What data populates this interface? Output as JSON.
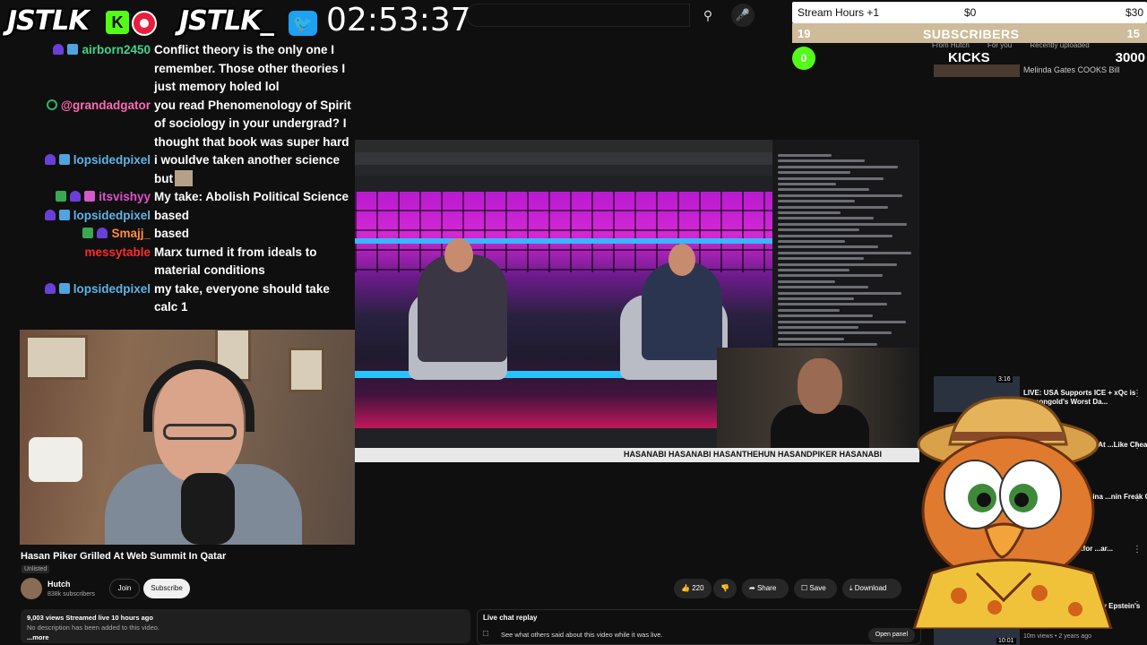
{
  "overlay": {
    "brand_left": "JSTLK",
    "kick_glyph": "K",
    "brand_right": "JSTLK_",
    "clock": "02:53:37",
    "twitter_glyph": "🐦"
  },
  "goals": {
    "hours_title": "Stream Hours +1",
    "hours_min": "$0",
    "hours_max": "$30",
    "subs_current": "19",
    "subs_label": "SUBSCRIBERS",
    "subs_goal": "15",
    "kicks_current": "0",
    "kicks_label": "KICKS",
    "kicks_goal": "3000"
  },
  "mini_tabs": [
    "From Hutch",
    "For you",
    "Recently uploaded"
  ],
  "mini_rec_title": "Melinda Gates COOKS Bill",
  "chat": [
    {
      "user": "airborn2450",
      "color": "#3dd68c",
      "badges": [
        "purple",
        "blue"
      ],
      "text": "Conflict theory is the only one I remember. Those other theories I just memory holed lol"
    },
    {
      "user": "@grandadgator",
      "color": "#ff69b4",
      "badges": [
        "circle"
      ],
      "text": "you read Phenomenology of Spirit of sociology in your undergrad? I thought that book was super hard"
    },
    {
      "user": "lopsidedpixel",
      "color": "#5fb3e8",
      "badges": [
        "purple",
        "blue"
      ],
      "text": "i wouldve taken another science but",
      "emote": true
    },
    {
      "user": "itsvishyy",
      "color": "#e04fcf",
      "badges": [
        "green",
        "purple",
        "pink"
      ],
      "text": "My take: Abolish Political Science"
    },
    {
      "user": "lopsidedpixel",
      "color": "#5fb3e8",
      "badges": [
        "purple",
        "blue"
      ],
      "text": "based"
    },
    {
      "user": "Smajj_",
      "color": "#ff8c3a",
      "badges": [
        "green",
        "purple"
      ],
      "text": "based"
    },
    {
      "user": "messytable",
      "color": "#ff2a2a",
      "badges": [],
      "text": "Marx turned it from ideals to material conditions"
    },
    {
      "user": "lopsidedpixel",
      "color": "#5fb3e8",
      "badges": [
        "purple",
        "blue"
      ],
      "text": "my take, everyone should take calc 1"
    }
  ],
  "embed": {
    "handles": "HASANABI   HASANABI   HASANTHEHUN   HASANDPIKER   HASANABI"
  },
  "video": {
    "title": "Hasan Piker Grilled At Web Summit In Qatar",
    "unlisted": "Unlisted",
    "channel": "Hutch",
    "subscribers": "838k subscribers",
    "join": "Join",
    "subscribe": "Subscribe",
    "likes": "220",
    "share": "Share",
    "save": "Save",
    "download": "Download",
    "views_line": "9,003 views  Streamed live 10 hours ago",
    "no_desc": "No description has been added to this video.",
    "more": "...more"
  },
  "live_chat_replay": {
    "title": "Live chat replay",
    "text": "See what others said about this video while it was live.",
    "button": "Open panel"
  },
  "recommendations": [
    {
      "title": "LIVE: USA Supports ICE + xQc is Asmongold's Worst Da...",
      "duration": "3:16"
    },
    {
      "title": "...ood At ...Like Cheating"
    },
    {
      "title": "...China ...nin Freak Out ..."
    },
    {
      "title": "...for ...ar..."
    },
    {
      "title": "...Jeffrey Epstein's",
      "meta": "10m views • 2 years ago",
      "duration": "10:01"
    }
  ],
  "colors": {
    "kick_green": "#53fc18",
    "twitter_blue": "#1da1f2",
    "subs_bar": "#cdbb9a",
    "background": "#0f0f0f"
  }
}
